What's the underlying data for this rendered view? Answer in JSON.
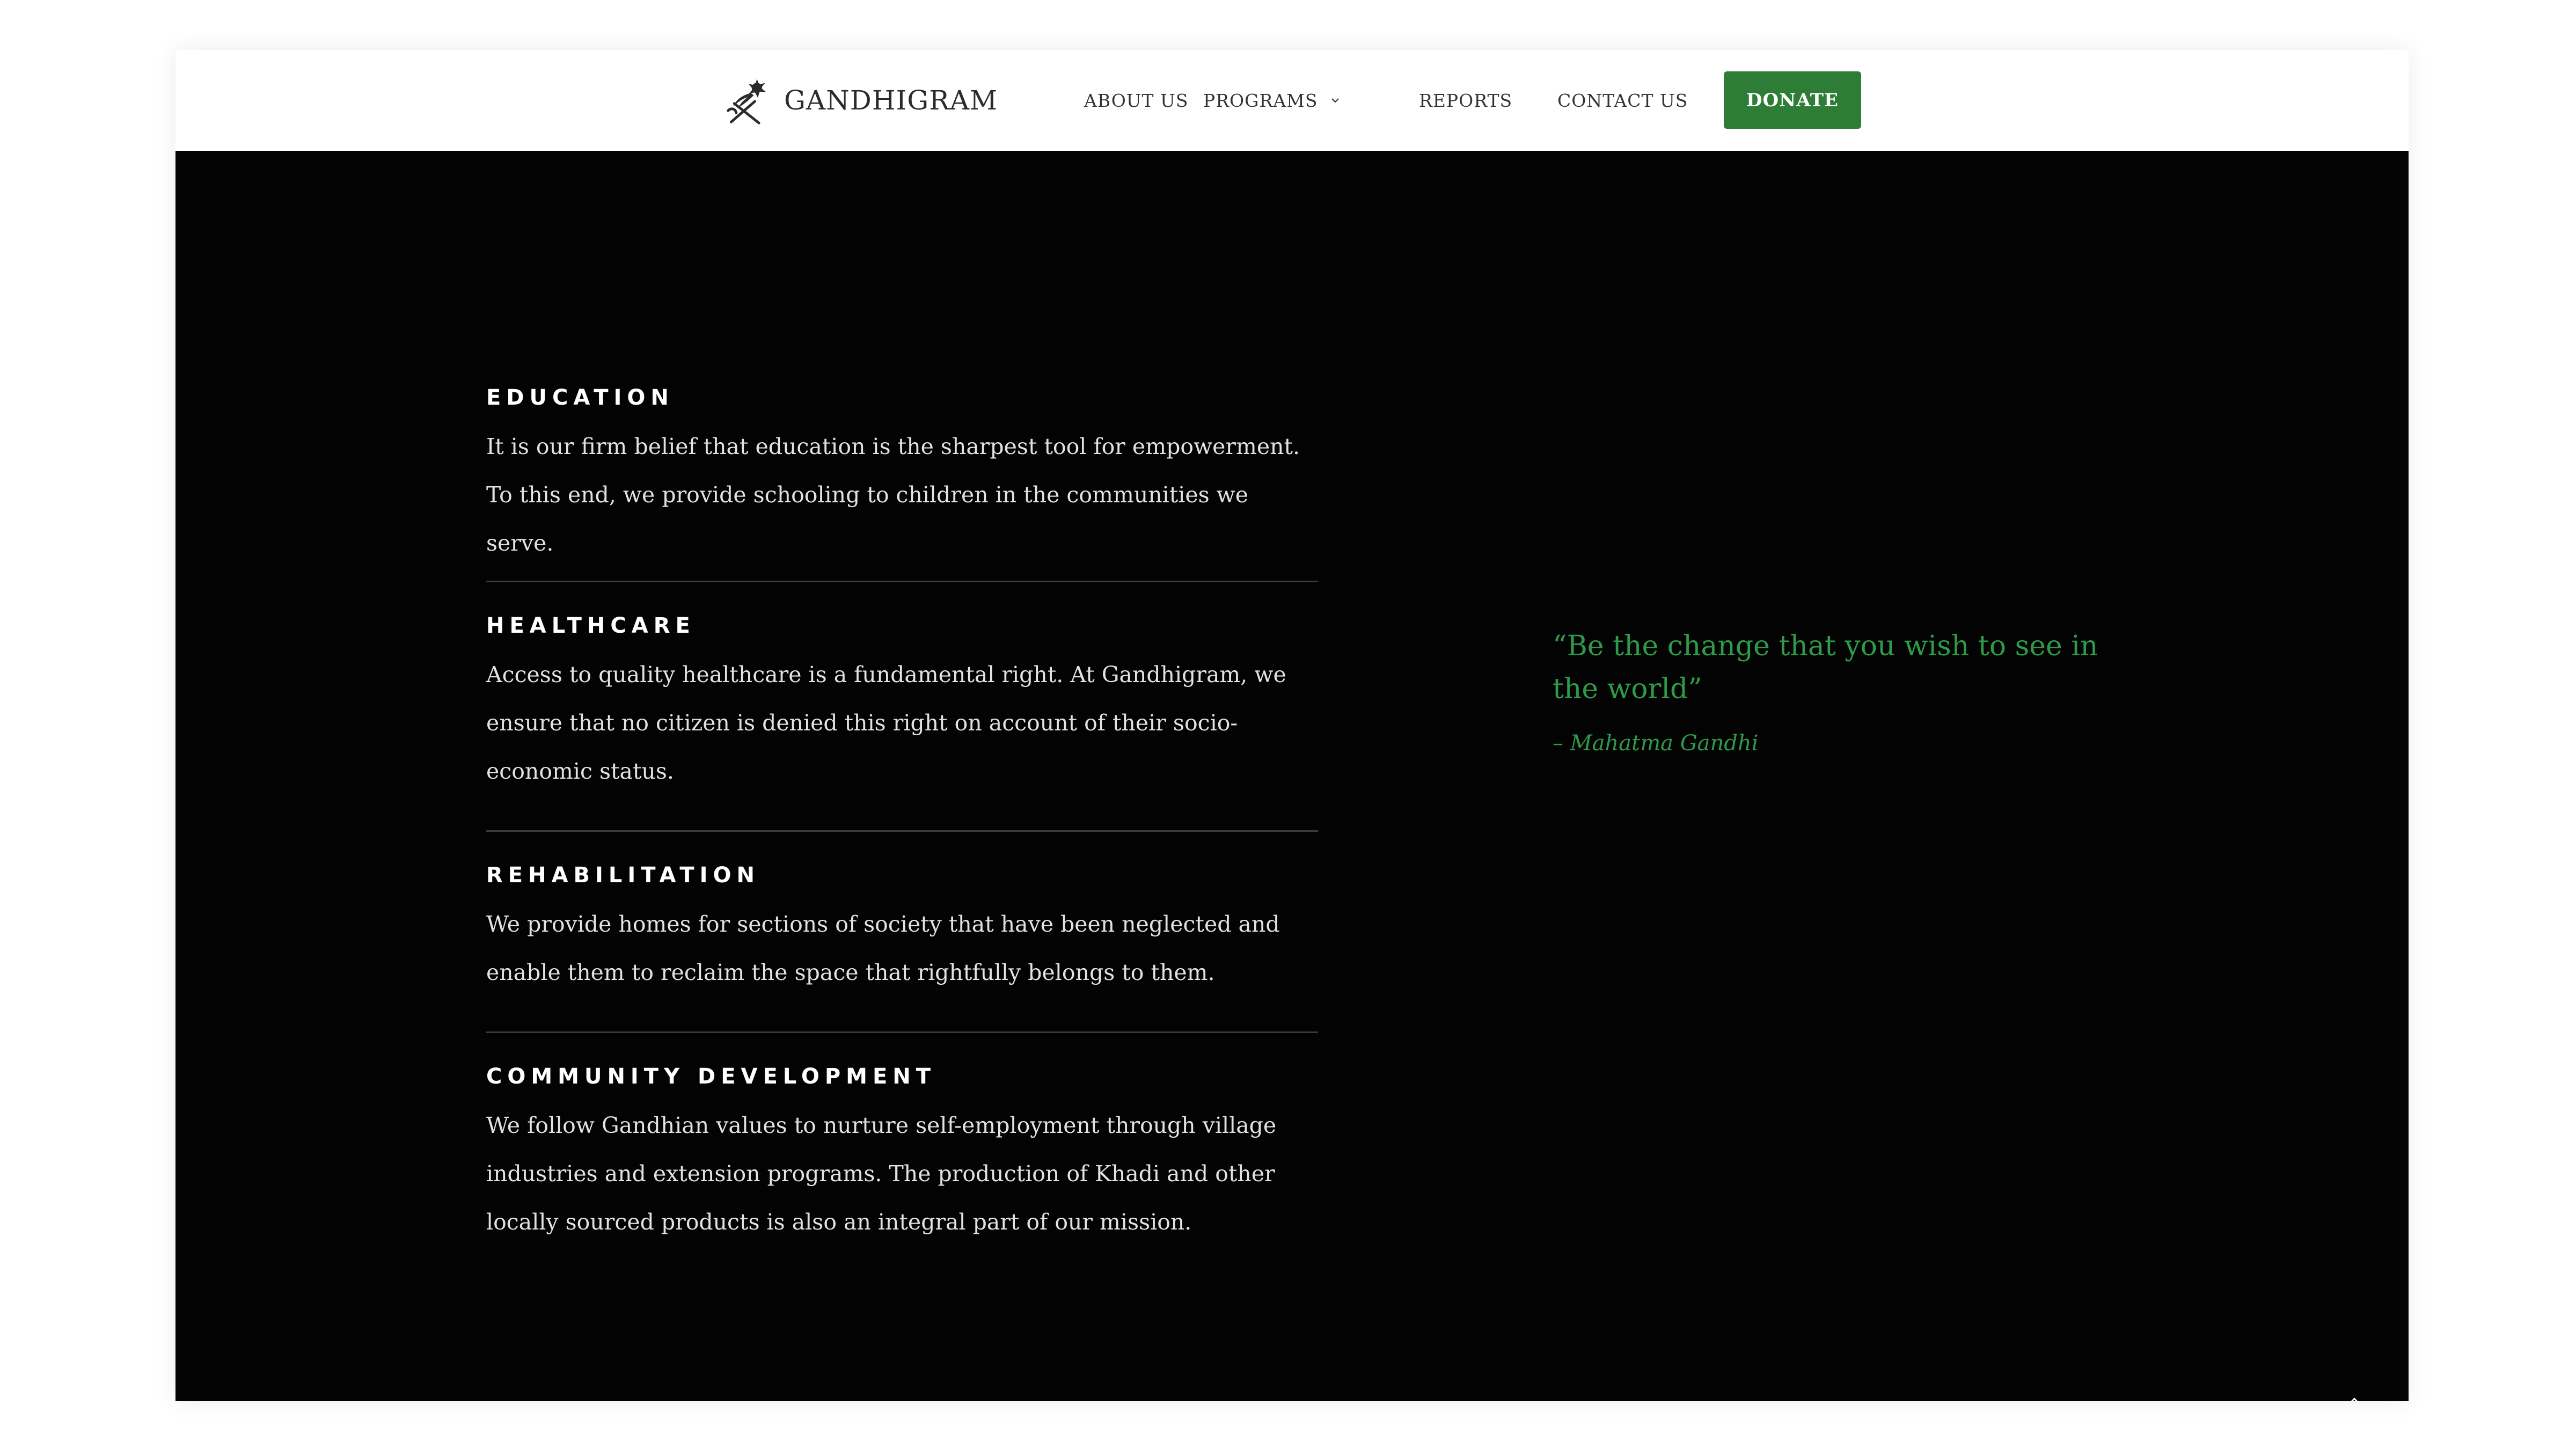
{
  "brand": {
    "name": "GANDHIGRAM",
    "logo_icon": "flower-bird-logo-icon"
  },
  "nav": {
    "items": [
      {
        "label": "ABOUT US"
      },
      {
        "label": "PROGRAMS",
        "has_dropdown": true
      },
      {
        "label": "REPORTS"
      },
      {
        "label": "CONTACT US"
      }
    ],
    "donate_label": "DONATE"
  },
  "programs": [
    {
      "title": "EDUCATION",
      "description": "It is our firm belief that education is the sharpest tool for empowerment. To this end, we provide schooling to children in the communities we serve."
    },
    {
      "title": "HEALTHCARE",
      "description": "Access to quality healthcare is a fundamental right. At Gandhigram, we ensure that no citizen is denied this right on account of their socio-economic status."
    },
    {
      "title": "REHABILITATION",
      "description": "We provide homes for sections of society that have been neglected and enable them to reclaim the space that rightfully belongs to them."
    },
    {
      "title": "COMMUNITY DEVELOPMENT",
      "description": "We follow Gandhian values to nurture self-employment through village industries and extension programs. The production of Khadi and other locally sourced products is also an integral part of our mission."
    }
  ],
  "quote": {
    "text": "“Be the change that you wish to see in the world”",
    "author": "– Mahatma Gandhi"
  },
  "colors": {
    "accent_green": "#2d7d37",
    "quote_green": "#2f9a49",
    "section_background": "#030303"
  },
  "icons": {
    "dropdown": "chevron-down-icon",
    "scroll_top": "chevron-up-icon"
  }
}
